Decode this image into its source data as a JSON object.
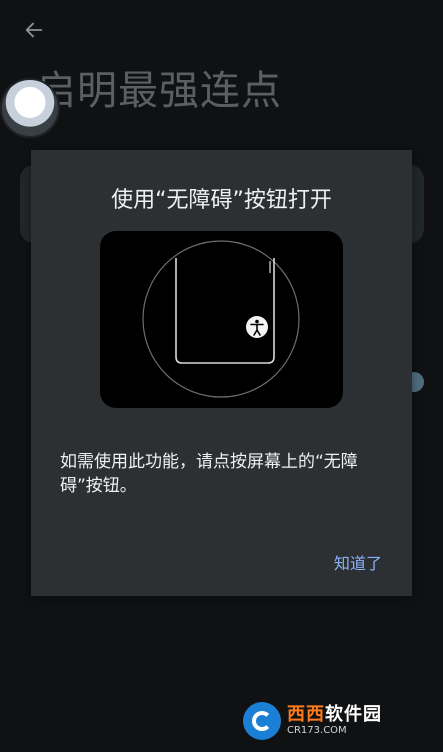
{
  "background": {
    "title": "启明最强连点"
  },
  "dialog": {
    "title": "使用“无障碍”按钮打开",
    "message": "如需使用此功能，请点按屏幕上的“无障碍”按钮。",
    "action": "知道了"
  },
  "watermark": {
    "brand": "西西",
    "suffix": "软件园",
    "url": "CR173.COM"
  },
  "colors": {
    "background": "#0f1113",
    "dialog": "#2d3032",
    "accent": "#8ab4f8"
  },
  "icons": {
    "back": "arrow-left-icon",
    "accessibility": "accessibility-icon"
  }
}
